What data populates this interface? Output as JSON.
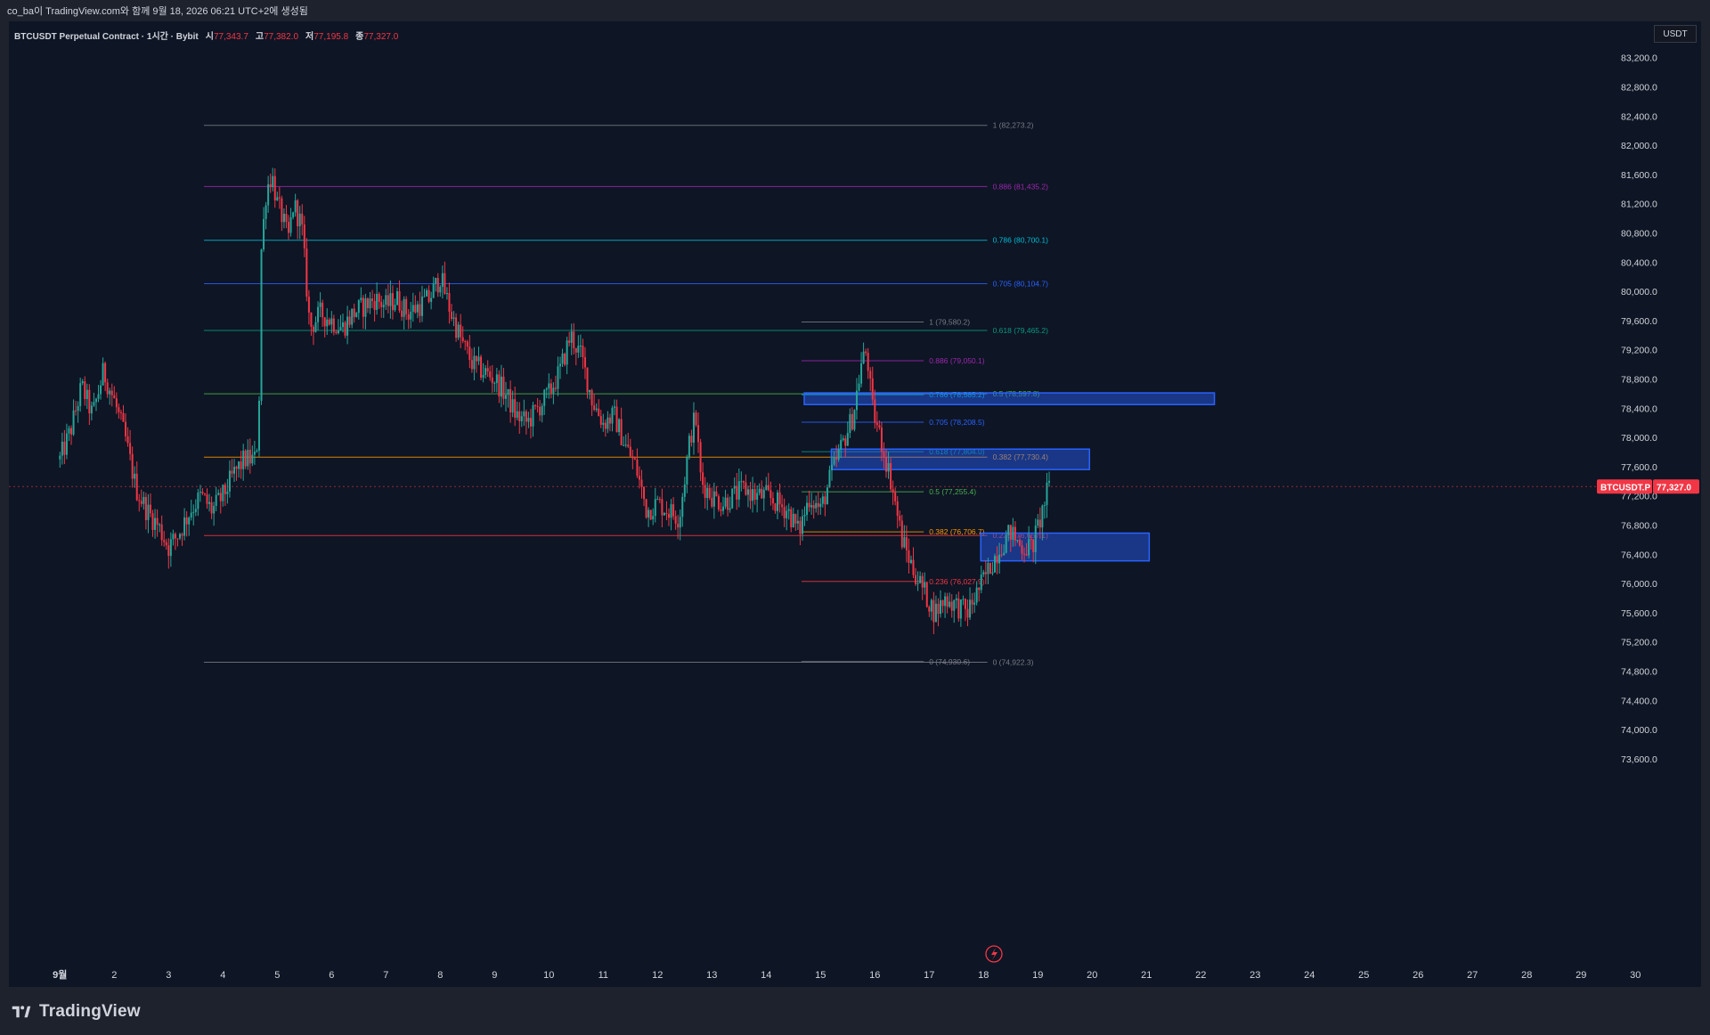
{
  "header": {
    "caption": "co_ba이 TradingView.com와 함께 9월 18, 2026 06:21 UTC+2에 생성됨"
  },
  "legend": {
    "symbol": "BTCUSDT Perpetual Contract · 1시간 · Bybit",
    "open_label": "시",
    "open": "77,343.7",
    "high_label": "고",
    "high": "77,382.0",
    "low_label": "저",
    "low": "77,195.8",
    "close_label": "종",
    "close": "77,327.0"
  },
  "currency": "USDT",
  "price_tag": {
    "symbol": "BTCUSDT.P",
    "value": "77,327.0",
    "price": 77327
  },
  "brand": "TradingView",
  "colors": {
    "up": "#26a69a",
    "down": "#f23645",
    "background": "#0e1524",
    "zone": "#1e53e5",
    "price_tag": "#f23645"
  },
  "chart_data": {
    "type": "candlestick",
    "timeframe": "1h",
    "ylim": [
      73400,
      83500
    ],
    "y_ticks": [
      83200,
      82800,
      82400,
      82000,
      81600,
      81200,
      80800,
      80400,
      80000,
      79600,
      79200,
      78800,
      78400,
      78000,
      77600,
      77200,
      76800,
      76400,
      76000,
      75600,
      75200,
      74800,
      74400,
      74000,
      73600
    ],
    "y_tick_labels": [
      "83,200.0",
      "82,800.0",
      "82,400.0",
      "82,000.0",
      "81,600.0",
      "81,200.0",
      "80,800.0",
      "80,400.0",
      "80,000.0",
      "79,600.0",
      "79,200.0",
      "78,800.0",
      "78,400.0",
      "78,000.0",
      "77,600.0",
      "77,200.0",
      "76,800.0",
      "76,400.0",
      "76,000.0",
      "75,600.0",
      "75,200.0",
      "74,800.0",
      "74,400.0",
      "74,000.0",
      "73,600.0"
    ],
    "x_ticks": [
      {
        "day": 1,
        "label": "9월"
      },
      {
        "day": 2,
        "label": "2"
      },
      {
        "day": 3,
        "label": "3"
      },
      {
        "day": 4,
        "label": "4"
      },
      {
        "day": 5,
        "label": "5"
      },
      {
        "day": 6,
        "label": "6"
      },
      {
        "day": 7,
        "label": "7"
      },
      {
        "day": 8,
        "label": "8"
      },
      {
        "day": 9,
        "label": "9"
      },
      {
        "day": 10,
        "label": "10"
      },
      {
        "day": 11,
        "label": "11"
      },
      {
        "day": 12,
        "label": "12"
      },
      {
        "day": 13,
        "label": "13"
      },
      {
        "day": 14,
        "label": "14"
      },
      {
        "day": 15,
        "label": "15"
      },
      {
        "day": 16,
        "label": "16"
      },
      {
        "day": 17,
        "label": "17"
      },
      {
        "day": 18,
        "label": "18"
      },
      {
        "day": 19,
        "label": "19"
      },
      {
        "day": 20,
        "label": "20"
      },
      {
        "day": 21,
        "label": "21"
      },
      {
        "day": 22,
        "label": "22"
      },
      {
        "day": 23,
        "label": "23"
      },
      {
        "day": 24,
        "label": "24"
      },
      {
        "day": 25,
        "label": "25"
      },
      {
        "day": 26,
        "label": "26"
      },
      {
        "day": 27,
        "label": "27"
      },
      {
        "day": 28,
        "label": "28"
      },
      {
        "day": 29,
        "label": "29"
      },
      {
        "day": 30,
        "label": "30"
      }
    ],
    "price_path": [
      [
        0.0,
        77700
      ],
      [
        0.2,
        78100
      ],
      [
        0.4,
        78700
      ],
      [
        0.6,
        78300
      ],
      [
        0.8,
        78900
      ],
      [
        1.0,
        78500
      ],
      [
        1.2,
        78000
      ],
      [
        1.4,
        77300
      ],
      [
        1.6,
        77000
      ],
      [
        1.8,
        76800
      ],
      [
        2.0,
        76500
      ],
      [
        2.2,
        76700
      ],
      [
        2.4,
        77000
      ],
      [
        2.6,
        77200
      ],
      [
        2.8,
        77000
      ],
      [
        3.0,
        77200
      ],
      [
        3.2,
        77500
      ],
      [
        3.4,
        77700
      ],
      [
        3.6,
        77700
      ],
      [
        3.66,
        78200
      ],
      [
        3.7,
        80500
      ],
      [
        3.8,
        81400
      ],
      [
        3.9,
        81600
      ],
      [
        4.0,
        81200
      ],
      [
        4.1,
        81000
      ],
      [
        4.2,
        80700
      ],
      [
        4.3,
        81200
      ],
      [
        4.45,
        80900
      ],
      [
        4.6,
        79500
      ],
      [
        4.8,
        79700
      ],
      [
        5.0,
        79600
      ],
      [
        5.2,
        79500
      ],
      [
        5.4,
        79700
      ],
      [
        5.6,
        79800
      ],
      [
        5.8,
        79900
      ],
      [
        6.0,
        79800
      ],
      [
        6.2,
        79900
      ],
      [
        6.4,
        79700
      ],
      [
        6.6,
        79800
      ],
      [
        6.8,
        79900
      ],
      [
        7.0,
        80200
      ],
      [
        7.2,
        79700
      ],
      [
        7.4,
        79300
      ],
      [
        7.6,
        79000
      ],
      [
        7.8,
        78900
      ],
      [
        8.0,
        78800
      ],
      [
        8.2,
        78600
      ],
      [
        8.4,
        78300
      ],
      [
        8.6,
        78200
      ],
      [
        8.8,
        78400
      ],
      [
        9.0,
        78600
      ],
      [
        9.2,
        78900
      ],
      [
        9.4,
        79400
      ],
      [
        9.6,
        79100
      ],
      [
        9.8,
        78500
      ],
      [
        10.0,
        78200
      ],
      [
        10.2,
        78300
      ],
      [
        10.4,
        77900
      ],
      [
        10.6,
        77600
      ],
      [
        10.8,
        77000
      ],
      [
        11.0,
        77100
      ],
      [
        11.2,
        77000
      ],
      [
        11.4,
        76900
      ],
      [
        11.6,
        78000
      ],
      [
        11.7,
        78300
      ],
      [
        11.8,
        77400
      ],
      [
        12.0,
        77200
      ],
      [
        12.2,
        77100
      ],
      [
        12.4,
        77200
      ],
      [
        12.6,
        77300
      ],
      [
        12.8,
        77200
      ],
      [
        13.0,
        77200
      ],
      [
        13.2,
        77100
      ],
      [
        13.4,
        77000
      ],
      [
        13.6,
        76700
      ],
      [
        13.8,
        77200
      ],
      [
        14.0,
        77000
      ],
      [
        14.2,
        77500
      ],
      [
        14.4,
        77900
      ],
      [
        14.6,
        78300
      ],
      [
        14.75,
        79000
      ],
      [
        14.85,
        79200
      ],
      [
        14.95,
        78400
      ],
      [
        15.1,
        78000
      ],
      [
        15.3,
        77400
      ],
      [
        15.5,
        76600
      ],
      [
        15.7,
        76200
      ],
      [
        15.9,
        75900
      ],
      [
        16.1,
        75600
      ],
      [
        16.3,
        75800
      ],
      [
        16.5,
        75700
      ],
      [
        16.7,
        75600
      ],
      [
        16.9,
        75900
      ],
      [
        17.1,
        76200
      ],
      [
        17.3,
        76500
      ],
      [
        17.5,
        76700
      ],
      [
        17.7,
        76500
      ],
      [
        17.9,
        76500
      ],
      [
        18.05,
        76900
      ],
      [
        18.2,
        77327
      ]
    ],
    "fib_levels": [
      {
        "label": "1 (82,273.2)",
        "price": 82273.2,
        "color": "#787b86",
        "from": 3.65,
        "to": 18.07
      },
      {
        "label": "0.886 (81,435.2)",
        "price": 81435.2,
        "color": "#9c27b0",
        "from": 3.65,
        "to": 18.07
      },
      {
        "label": "0.786 (80,700.1)",
        "price": 80700.1,
        "color": "#00bcd4",
        "from": 3.65,
        "to": 18.07
      },
      {
        "label": "0.705 (80,104.7)",
        "price": 80104.7,
        "color": "#2962ff",
        "from": 3.65,
        "to": 18.07
      },
      {
        "label": "0.618 (79,465.2)",
        "price": 79465.2,
        "color": "#089981",
        "from": 3.65,
        "to": 18.07
      },
      {
        "label": "0.5 (78,597.8)",
        "price": 78597.8,
        "color": "#4caf50",
        "from": 3.65,
        "to": 18.07
      },
      {
        "label": "0.382 (77,730.4)",
        "price": 77730.4,
        "color": "#ff9800",
        "from": 3.65,
        "to": 18.07
      },
      {
        "label": "0.236 (76,657.1)",
        "price": 76657.1,
        "color": "#f23645",
        "from": 3.65,
        "to": 18.07
      },
      {
        "label": "0 (74,922.3)",
        "price": 74922.3,
        "color": "#787b86",
        "from": 3.65,
        "to": 18.07
      },
      {
        "label": "1 (79,580.2)",
        "price": 79580.2,
        "color": "#787b86",
        "from": 14.65,
        "to": 16.9
      },
      {
        "label": "0.886 (79,050.1)",
        "price": 79050.1,
        "color": "#9c27b0",
        "from": 14.65,
        "to": 16.9
      },
      {
        "label": "0.786 (78,585.2)",
        "price": 78585.2,
        "color": "#00bcd4",
        "from": 14.65,
        "to": 16.9
      },
      {
        "label": "0.705 (78,208.5)",
        "price": 78208.5,
        "color": "#2962ff",
        "from": 14.65,
        "to": 16.9
      },
      {
        "label": "0.618 (77,804.0)",
        "price": 77804.0,
        "color": "#089981",
        "from": 14.65,
        "to": 16.9
      },
      {
        "label": "0.5 (77,255.4)",
        "price": 77255.4,
        "color": "#4caf50",
        "from": 14.65,
        "to": 16.9
      },
      {
        "label": "0.382 (76,706.7)",
        "price": 76706.7,
        "color": "#ff9800",
        "from": 14.65,
        "to": 16.9
      },
      {
        "label": "0.236 (76,027.9)",
        "price": 76027.9,
        "color": "#f23645",
        "from": 14.65,
        "to": 16.9
      },
      {
        "label": "0 (74,930.6)",
        "price": 74930.6,
        "color": "#787b86",
        "from": 14.65,
        "to": 16.9
      }
    ],
    "zones": [
      {
        "day_from": 14.7,
        "day_to": 22.25,
        "price_top": 78610,
        "price_bottom": 78450
      },
      {
        "day_from": 15.2,
        "day_to": 19.95,
        "price_top": 77840,
        "price_bottom": 77560
      },
      {
        "day_from": 17.95,
        "day_to": 21.05,
        "price_top": 76690,
        "price_bottom": 76310
      }
    ]
  }
}
